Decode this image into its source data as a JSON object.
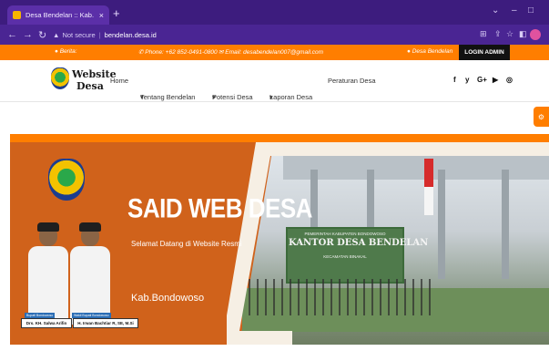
{
  "browser": {
    "tab_title": "Desa Bendelan :: Kab. Bondowo...",
    "tab_close": "×",
    "new_tab": "+",
    "security": "Not secure",
    "url": "bendelan.desa.id"
  },
  "infobar": {
    "news_label": "Berita:",
    "phone": "Phone: +62 852-0491-0800",
    "email": "Email: desabendelan007@gmail.com",
    "village": "Desa Bendelan",
    "login": "LOGIN ADMIN"
  },
  "header": {
    "logo_line1": "Website",
    "logo_line2": "Desa",
    "menu": [
      "Home",
      "Tentang Bendelan",
      "Potensi Desa",
      "Laporan Desa",
      "Peraturan Desa"
    ],
    "dropdown_glyph": "▾",
    "social": [
      "f",
      "y",
      "G+",
      "▶",
      "◎"
    ]
  },
  "hero": {
    "title": "SAID WEB DESA",
    "subtitle": "Selamat Datang di Website Resmi",
    "region": "Kab.Bondowoso",
    "sign_top": "PEMERINTAH KABUPATEN BONDOWOSO",
    "sign_main": "KANTOR DESA BENDELAN",
    "sign_bottom": "KECAMATAN BINAKAL",
    "person1_role": "Bupati Bondowoso",
    "person1_name": "Drs. KH. Salwa Arifin",
    "person2_role": "Wakil Bupati Bondowoso",
    "person2_name": "H. Irwan Bachtiar R, SE, M.Si"
  },
  "colors": {
    "brand_orange": "#ff7e00",
    "browser_purple": "#3d1c7e",
    "hero_orange": "#d0621b"
  }
}
